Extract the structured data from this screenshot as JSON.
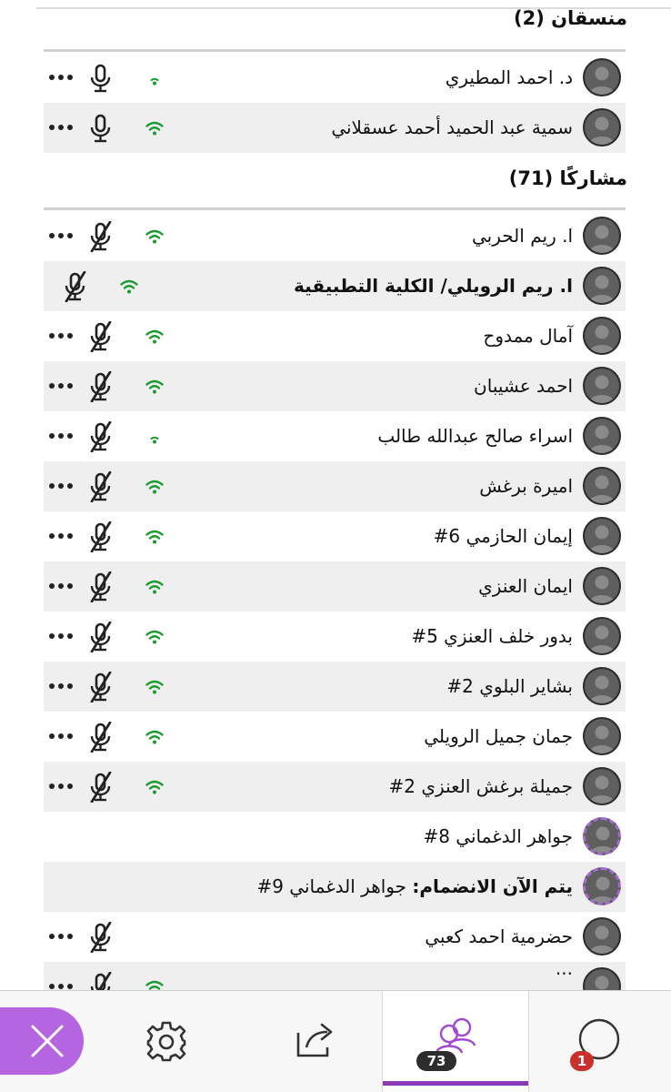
{
  "sections": {
    "moderators_title": "منسقان (2)",
    "participants_title": "مشاركًا (71)"
  },
  "moderators": [
    {
      "name": "د. احمد المطيري",
      "bold": false,
      "signal": "weak",
      "muted": false,
      "more": true
    },
    {
      "name": "سمية عبد الحميد أحمد عسقلاني",
      "bold": false,
      "signal": "strong",
      "muted": false,
      "more": true
    }
  ],
  "participants": [
    {
      "name": "ا. ريم الحربي",
      "bold": false,
      "signal": "strong",
      "muted": true,
      "more": true
    },
    {
      "name": "ا. ريم الرويلي/ الكلية التطبيقية",
      "bold": true,
      "signal": "strong",
      "muted": true,
      "more": false
    },
    {
      "name": "آمال ممدوح",
      "bold": false,
      "signal": "strong",
      "muted": true,
      "more": true
    },
    {
      "name": "احمد عشيبان",
      "bold": false,
      "signal": "strong",
      "muted": true,
      "more": true
    },
    {
      "name": "اسراء صالح عبدالله طالب",
      "bold": false,
      "signal": "weak",
      "muted": true,
      "more": true
    },
    {
      "name": "اميرة برغش",
      "bold": false,
      "signal": "strong",
      "muted": true,
      "more": true
    },
    {
      "name": "إيمان الحازمي 6#",
      "bold": false,
      "signal": "strong",
      "muted": true,
      "more": true
    },
    {
      "name": "ايمان العنزي",
      "bold": false,
      "signal": "strong",
      "muted": true,
      "more": true
    },
    {
      "name": "بدور خلف العنزي 5#",
      "bold": false,
      "signal": "strong",
      "muted": true,
      "more": true
    },
    {
      "name": "بشاير البلوي 2#",
      "bold": false,
      "signal": "strong",
      "muted": true,
      "more": true
    },
    {
      "name": "جمان جميل الرويلي",
      "bold": false,
      "signal": "strong",
      "muted": true,
      "more": true
    },
    {
      "name": "جميلة برغش العنزي 2#",
      "bold": false,
      "signal": "strong",
      "muted": true,
      "more": true
    },
    {
      "name": "جواهر الدغماني 8#",
      "bold": false,
      "signal": "none",
      "muted": false,
      "more": false,
      "joining": true
    },
    {
      "name": "يتم الآن الانضمام: جواهر الدغماني 9#",
      "bold": false,
      "bold_prefix": "يتم الآن الانضمام:",
      "name_rest": " جواهر الدغماني 9#",
      "signal": "none",
      "muted": false,
      "more": false,
      "joining": true
    },
    {
      "name": "حضرمية احمد كعبي",
      "bold": false,
      "signal": "none",
      "muted": true,
      "more": true
    },
    {
      "name": "...",
      "bold": false,
      "signal": "strong",
      "muted": true,
      "more": true,
      "cut": true
    }
  ],
  "bottom_bar": {
    "close_icon": "close-icon",
    "settings_icon": "gear-icon",
    "share_icon": "share-icon",
    "people_icon": "people-icon",
    "people_count": "73",
    "chat_icon": "chat-icon",
    "chat_count": "1"
  },
  "colors": {
    "accent": "#8c3ab8",
    "close_button": "#b565e0",
    "signal_green": "#1a9b2e",
    "badge_red": "#c9302c",
    "row_shade": "#efefef"
  }
}
